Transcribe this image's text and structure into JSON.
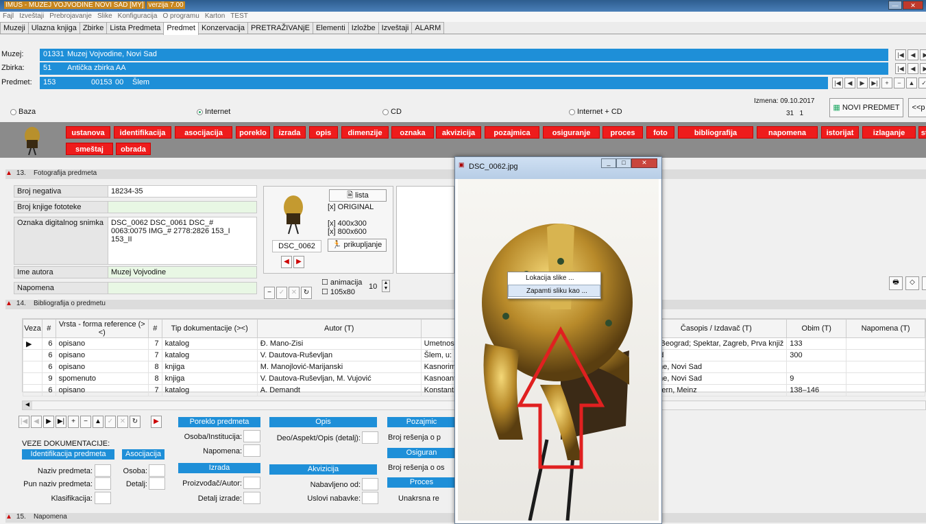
{
  "window": {
    "title": "IMUS - MUZEJ VOJVODINE NOVI SAD [MY]",
    "version": "verzija 7.00"
  },
  "menu": [
    "Fajl",
    "Izveštaji",
    "Prebrojavanje",
    "Slike",
    "Konfiguracija",
    "O programu",
    "Karton",
    "TEST"
  ],
  "tabs": [
    "Muzeji",
    "Ulazna knjiga",
    "Zbirke",
    "Lista Predmeta",
    "Predmet",
    "Konzervacija",
    "PRETRAŽIVANjE",
    "Elementi",
    "Izložbe",
    "Izveštaji",
    "ALARM"
  ],
  "active_tab": "Predmet",
  "muzej": {
    "label": "Muzej:",
    "code": "01331",
    "name": "Muzej Vojvodine, Novi Sad"
  },
  "zbirka": {
    "label": "Zbirka:",
    "code": "51",
    "name": "Antička zbirka AA"
  },
  "predmet": {
    "label": "Predmet:",
    "code": "153",
    "inv": "00153",
    "sub": "00",
    "name": "Šlem"
  },
  "source": {
    "baza": "Baza",
    "internet": "Internet",
    "cd": "CD",
    "internet_cd": "Internet + CD",
    "selected": "Internet"
  },
  "izmena": {
    "label": "Izmena:",
    "date": "09.10.2017",
    "n1": "31",
    "n2": "1"
  },
  "novi_predmet": "NOVI PREDMET",
  "prev_btn": "<<p",
  "red_buttons_row1": [
    "ustanova",
    "identifikacija",
    "asocijacija",
    "poreklo",
    "izrada",
    "opis",
    "dimenzije",
    "oznaka",
    "akvizicija",
    "pozajmica",
    "osiguranje",
    "proces",
    "foto",
    "bibliografija",
    "napomena",
    "istorijat",
    "izlaganje",
    "status"
  ],
  "red_buttons_row2": [
    "smeštaj",
    "obrada"
  ],
  "sec13": {
    "num": "13.",
    "title": "Fotografija predmeta"
  },
  "photo": {
    "broj_negativa_label": "Broj negativa",
    "broj_negativa": "18234-35",
    "broj_knjige_label": "Broj knjige fototeke",
    "broj_knjige": "",
    "oznaka_label": "Oznaka digitalnog snimka",
    "oznaka": "DSC_0062 DSC_0061 DSC_# 0063:0075 IMG_# 2778:2826 153_I 153_II",
    "autor_label": "Ime autora",
    "autor": "Muzej Vojvodine",
    "napomena_label": "Napomena",
    "napomena": "",
    "thumb_caption": "DSC_0062",
    "lista": "lista",
    "original": "[x] ORIGINAL",
    "s400": "[x] 400x300",
    "s800": "[x] 800x600",
    "prikupljanje": "prikupljanje",
    "animacija": "animacija",
    "anim_value": "10",
    "size105": "105x80"
  },
  "sec14": {
    "num": "14.",
    "title": "Bibliografija o predmetu"
  },
  "bib_headers": [
    "Veza",
    "#",
    "Vrsta - forma reference (><)",
    "#",
    "Tip dokumentacije (><)",
    "Autor (T)",
    "",
    "Časopis / Izdavač (T)",
    "Obim (T)",
    "Napomena (T)"
  ],
  "bib_rows": [
    [
      "6",
      "opisano",
      "7",
      "katalog",
      "Đ. Mano-Zisi",
      "Umetnost na t",
      "ija, Beograd; Spektar, Zagreb, Prva knjiž",
      "133",
      ""
    ],
    [
      "6",
      "opisano",
      "7",
      "katalog",
      "V. Dautova-Ruševljan",
      "Šlem, u: Rims",
      "grad",
      "300",
      ""
    ],
    [
      "6",
      "opisano",
      "8",
      "knjiga",
      "M. Manojlović-Marijanski",
      "Kasnorimski š",
      "odine, Novi Sad",
      "",
      ""
    ],
    [
      "9",
      "spomenuto",
      "8",
      "knjiga",
      "V. Dautova-Ruševljan, M. Vujović",
      "Kasnoantički š",
      "odine, Novi Sad",
      "9",
      ""
    ],
    [
      "6",
      "opisano",
      "7",
      "katalog",
      "A. Demandt",
      "Konstantin un",
      "Zabern, Meinz",
      "138–146",
      ""
    ]
  ],
  "veze": {
    "title": "VEZE DOKUMENTACIJE:",
    "identifikacija": "Identifikacija predmeta",
    "naziv": "Naziv predmeta:",
    "pun_naziv": "Pun naziv predmeta:",
    "klasifikacija": "Klasifikacija:",
    "asocijacija": "Asocijacija",
    "osoba": "Osoba:",
    "detalj": "Detalj:",
    "poreklo": "Poreklo predmeta",
    "osoba_inst": "Osoba/Institucija:",
    "napomena": "Napomena:",
    "izrada": "Izrada",
    "proizvodjac": "Proizvođač/Autor:",
    "detalj_izrade": "Detalj izrade:",
    "opis": "Opis",
    "deo_aspekt": "Deo/Aspekt/Opis (detalj):",
    "akvizicija": "Akvizicija",
    "nabavljeno": "Nabavljeno od:",
    "uslovi": "Uslovi nabavke:",
    "pozajmica": "Pozajmic",
    "broj_resenja_p": "Broj rešenja o p",
    "osiguranje": "Osiguran",
    "broj_resenja_o": "Broj rešenja o os",
    "proces": "Proces",
    "unakrsna": "Unakrsna re"
  },
  "sec15": {
    "num": "15.",
    "title": "Napomena"
  },
  "viewer": {
    "title": "DSC_0062.jpg",
    "ctx_items": [
      "Lokacija slike ...",
      "Zapamti sliku kao ..."
    ]
  }
}
